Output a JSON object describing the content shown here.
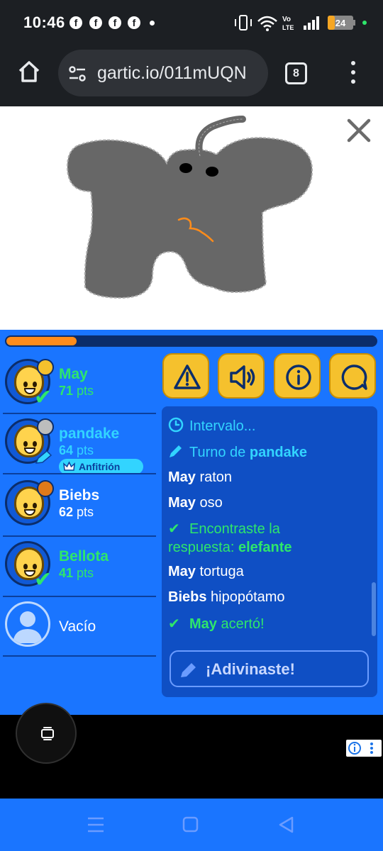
{
  "status_bar": {
    "time": "10:46",
    "notification_icons": [
      "facebook-icon",
      "facebook-icon",
      "facebook-icon",
      "facebook-icon"
    ],
    "battery_level": "24",
    "network_label_top": "Vo",
    "network_label_bottom": "LTE"
  },
  "browser": {
    "url": "gartic.io/011mUQN",
    "tab_count": "8"
  },
  "game": {
    "timer_progress": 0.19,
    "players": [
      {
        "name": "May",
        "points": "71",
        "unit": "pts",
        "badge_color": "#f5c12d",
        "status": "guessed",
        "name_color": "#2ee66b"
      },
      {
        "name": "pandake",
        "points": "64",
        "unit": "pts",
        "badge_color": "#bdbdbd",
        "status": "drawing",
        "name_color": "#32d4ff",
        "role": "Anfitrión"
      },
      {
        "name": "Biebs",
        "points": "62",
        "unit": "pts",
        "badge_color": "#e07a1a",
        "status": "none",
        "name_color": "#ffffff"
      },
      {
        "name": "Bellota",
        "points": "41",
        "unit": "pts",
        "badge_color": null,
        "status": "guessed",
        "name_color": "#2ee66b"
      },
      {
        "name": "Vacío",
        "points": "",
        "unit": "",
        "status": "empty",
        "name_color": "#ffffff"
      }
    ],
    "tools": [
      "report-icon",
      "sound-icon",
      "info-icon",
      "chat-icon"
    ],
    "chat": {
      "interval": "Intervalo...",
      "turn_prefix": "Turno de ",
      "turn_player": "pandake",
      "messages": [
        {
          "user": "May",
          "text": "raton"
        },
        {
          "user": "May",
          "text": "oso"
        }
      ],
      "found_line1": "Encontraste la",
      "found_line2_prefix": "respuesta: ",
      "found_answer": "elefante",
      "messages2": [
        {
          "user": "May",
          "text": "tortuga"
        },
        {
          "user": "Biebs",
          "text": "hipopótamo"
        }
      ],
      "correct_user": "May",
      "correct_text": "acertó!",
      "guess_button": "¡Adivinaste!"
    }
  },
  "colors": {
    "game_bg": "#1a75ff",
    "chat_bg": "#0f4fc4",
    "accent_yellow": "#f5c12d",
    "success_green": "#2ee66b",
    "system_cyan": "#32d4ff",
    "timer_orange": "#ff8c1a"
  }
}
